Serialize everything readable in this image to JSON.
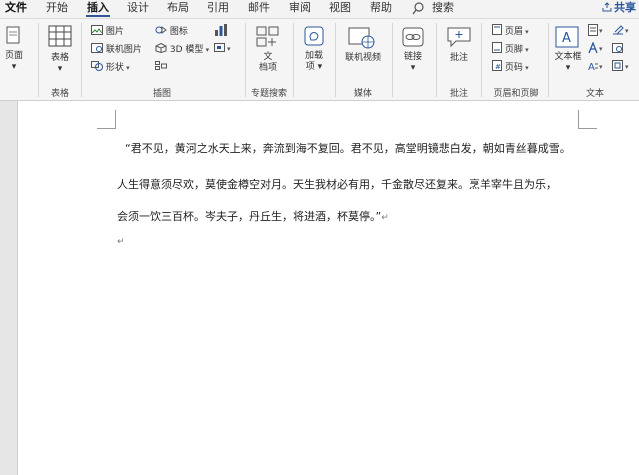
{
  "menubar": {
    "file": "文件",
    "tabs": [
      "开始",
      "插入",
      "设计",
      "布局",
      "引用",
      "邮件",
      "审阅",
      "视图",
      "帮助"
    ],
    "active_tab": "插入",
    "search_label": "搜索",
    "share_label": "共享"
  },
  "ribbon": {
    "pages": {
      "label": "页面"
    },
    "tables": {
      "button": "表格",
      "group": "表格"
    },
    "illustrations": {
      "picture": "图片",
      "online_picture": "联机图片",
      "shapes": "形状",
      "icons": "图标",
      "model3d": "3D 模型",
      "group": "插图"
    },
    "addins": {
      "button_line1": "文",
      "button_line2": "档项",
      "group": "专题搜索"
    },
    "get_addins": {
      "line1": "加载",
      "line2": "项"
    },
    "media": {
      "button": "联机视频",
      "group": "媒体"
    },
    "links": {
      "button": "链接"
    },
    "comments": {
      "button": "批注",
      "group": "批注"
    },
    "header_footer": {
      "header": "页眉",
      "footer": "页脚",
      "page_number": "页码",
      "group": "页眉和页脚"
    },
    "text": {
      "textbox": "文本框",
      "group": "文本"
    }
  },
  "document": {
    "lines": [
      "“君不见，黄河之水天上来，奔流到海不复回。君不见，高堂明镜悲白发，朝如青丝暮成雪。",
      "人生得意须尽欢，莫使金樽空对月。天生我材必有用，千金散尽还复来。烹羊宰牛且为乐，",
      "会须一饮三百杯。岑夫子，丹丘生，将进酒，杯莫停。”"
    ],
    "paragraph_mark": "↵"
  }
}
